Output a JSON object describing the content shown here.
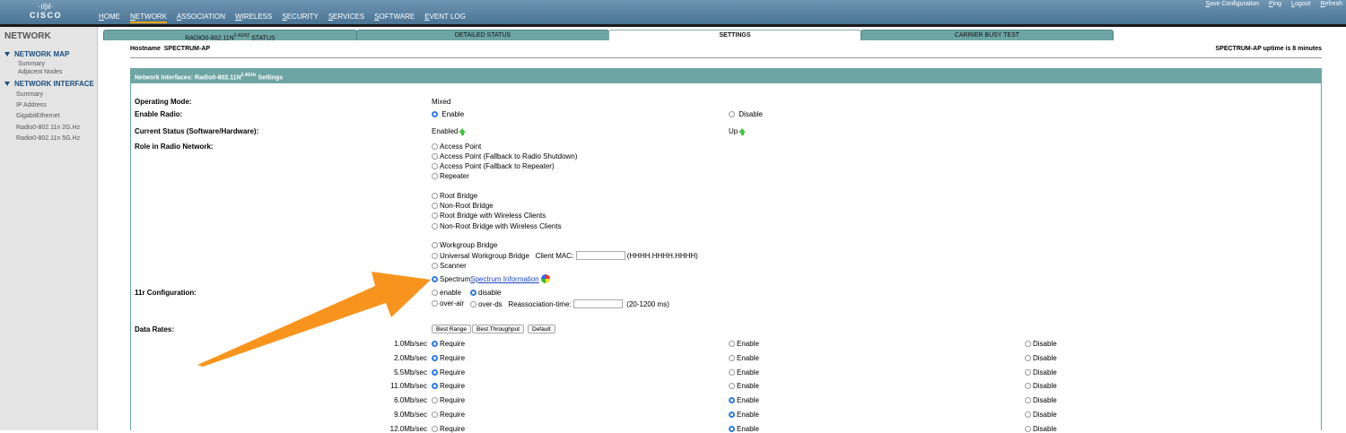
{
  "header": {
    "logo_bars": "·ıl|ıl·",
    "logo_text": "CISCO",
    "nav": [
      "HOME",
      "NETWORK",
      "ASSOCIATION",
      "WIRELESS",
      "SECURITY",
      "SERVICES",
      "SOFTWARE",
      "EVENT LOG"
    ],
    "active_nav": "NETWORK",
    "utility_links": [
      "Save Configuration",
      "Ping",
      "Logout",
      "Refresh"
    ],
    "colors": {
      "header": "#5a83a3",
      "accent": "#f2a500",
      "teal": "#6da5a4"
    }
  },
  "sidebar": {
    "title": "NETWORK",
    "sections": [
      {
        "label": "NETWORK MAP",
        "items": [
          "Summary",
          "Adjacent Nodes"
        ]
      },
      {
        "label": "NETWORK INTERFACE",
        "items": [
          "Summary",
          "IP Address",
          "GigabitEthernet",
          "Radio0-802.11n 2G.Hz",
          "Radio0-802.11n 5G.Hz"
        ]
      }
    ]
  },
  "tabs": [
    {
      "label": "RADIO0-802.11N",
      "sup": "2.4GHZ",
      "label_suffix": " STATUS"
    },
    {
      "label": "DETAILED STATUS"
    },
    {
      "label": "SETTINGS",
      "active": true
    },
    {
      "label": "CARRIER BUSY TEST"
    }
  ],
  "host": {
    "label": "Hostname",
    "name": "SPECTRUM-AP",
    "uptime": "SPECTRUM-AP uptime is 8 minutes"
  },
  "section": {
    "title_prefix": "Network Interfaces: Radio0-802.11N",
    "title_sup": "2.4GHz",
    "title_suffix": " Settings"
  },
  "form": {
    "operating_mode": {
      "label": "Operating Mode:",
      "value": "Mixed"
    },
    "enable_radio": {
      "label": "Enable Radio:",
      "enable": "Enable",
      "disable": "Disable"
    },
    "current_status": {
      "label": "Current Status (Software/Hardware):",
      "software": "Enabled",
      "hardware": "Up"
    },
    "role": {
      "label": "Role in Radio Network:",
      "group1": [
        "Access Point",
        "Access Point (Fallback to Radio Shutdown)",
        "Access Point (Fallback to Repeater)",
        "Repeater"
      ],
      "group2": [
        "Root Bridge",
        "Non-Root Bridge",
        "Root Bridge with Wireless Clients",
        "Non-Root Bridge with Wireless Clients"
      ],
      "group3": [
        "Workgroup Bridge",
        "Universal Workgroup Bridge",
        "Scanner"
      ],
      "client_mac_label": "Client MAC:",
      "client_mac_value": "",
      "client_mac_hint": "(HHHH.HHHH.HHHH)",
      "spectrum": "Spectrum",
      "spectrum_link": "Spectrum Information",
      "selected": "Spectrum"
    },
    "r11": {
      "label": "11r Configuration:",
      "enable": "enable",
      "disable": "disable",
      "over_air": "over-air",
      "over_ds": "over-ds",
      "reassoc_label": "Reassociation-time:",
      "reassoc_value": "",
      "reassoc_hint": "(20-1200 ms)"
    },
    "data_rates": {
      "label": "Data Rates:",
      "buttons": [
        "Best Range",
        "Best Throughput",
        "Default"
      ],
      "columns": [
        "Require",
        "Enable",
        "Disable"
      ],
      "rows": [
        {
          "rate": "1.0Mb/sec",
          "selected": "Require"
        },
        {
          "rate": "2.0Mb/sec",
          "selected": "Require"
        },
        {
          "rate": "5.5Mb/sec",
          "selected": "Require"
        },
        {
          "rate": "11.0Mb/sec",
          "selected": "Require"
        },
        {
          "rate": "6.0Mb/sec",
          "selected": "Enable"
        },
        {
          "rate": "9.0Mb/sec",
          "selected": "Enable"
        },
        {
          "rate": "12.0Mb/sec",
          "selected": "Enable"
        }
      ]
    }
  },
  "annotation": {
    "arrow_color": "#f7941d"
  }
}
